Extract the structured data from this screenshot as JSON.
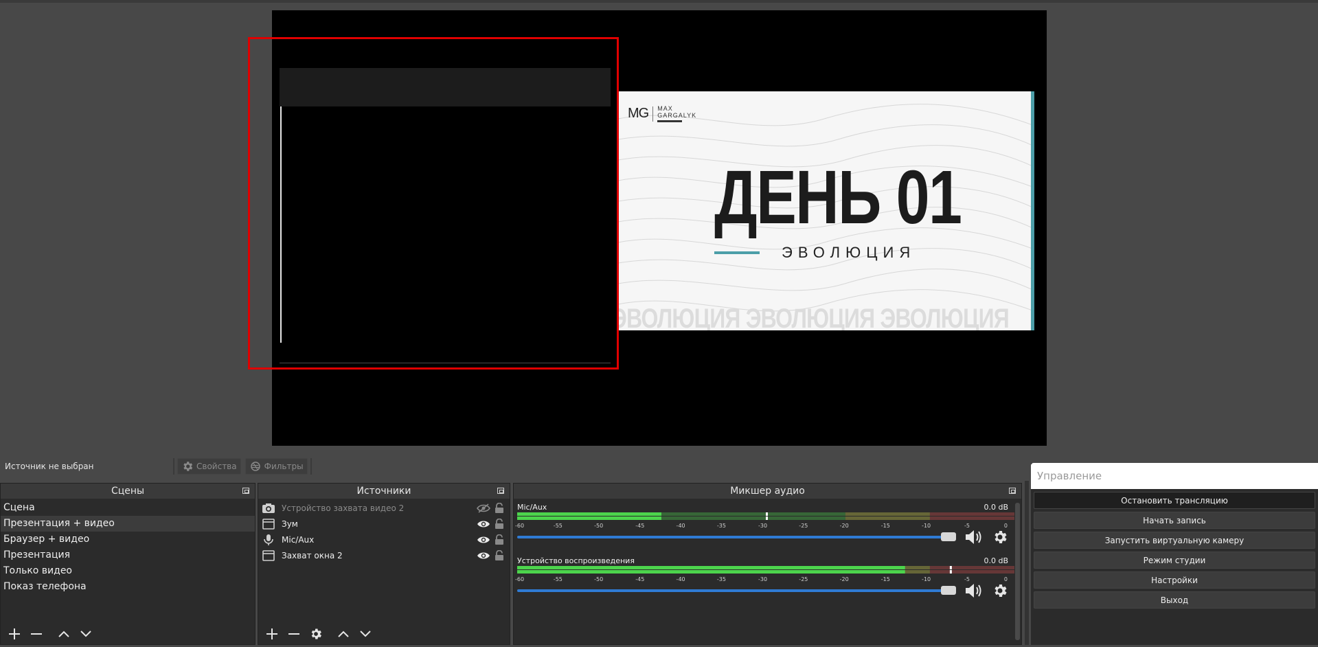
{
  "preview": {
    "slide_logo_mark": "MG",
    "slide_logo_name_line1": "MAX",
    "slide_logo_name_line2": "GARGALYK",
    "slide_title": "ДЕНЬ 01",
    "slide_subtitle": "ЭВОЛЮЦИЯ",
    "slide_repeat": "ЭВОЛЮЦИЯ ЭВОЛЮЦИЯ ЭВОЛЮЦИЯ"
  },
  "source_bar": {
    "status": "Источник не выбран",
    "properties_label": "Свойства",
    "filters_label": "Фильтры"
  },
  "scenes": {
    "title": "Сцены",
    "items": [
      {
        "label": "Сцена",
        "selected": false
      },
      {
        "label": "Презентация + видео",
        "selected": true
      },
      {
        "label": "Браузер + видео",
        "selected": false
      },
      {
        "label": "Презентация",
        "selected": false
      },
      {
        "label": "Только видео",
        "selected": false
      },
      {
        "label": "Показ телефона",
        "selected": false
      }
    ]
  },
  "sources": {
    "title": "Источники",
    "items": [
      {
        "label": "Устройство захвата видео 2",
        "icon": "camera-icon",
        "visible": false
      },
      {
        "label": "Зум",
        "icon": "window-icon",
        "visible": true
      },
      {
        "label": "Mic/Aux",
        "icon": "microphone-icon",
        "visible": true
      },
      {
        "label": "Захват окна 2",
        "icon": "window-icon",
        "visible": true
      }
    ]
  },
  "mixer": {
    "title": "Микшер аудио",
    "tick_labels": [
      "-60",
      "-55",
      "-50",
      "-45",
      "-40",
      "-35",
      "-30",
      "-25",
      "-20",
      "-15",
      "-10",
      "-5",
      "0"
    ],
    "channels": [
      {
        "name": "Mic/Aux",
        "db": "0.0 dB",
        "level_fraction": 0.29,
        "peak_fraction": 0.5,
        "volume_fraction": 1.0
      },
      {
        "name": "Устройство воспроизведения",
        "db": "0.0 dB",
        "level_fraction": 0.78,
        "peak_fraction": 0.87,
        "volume_fraction": 1.0
      }
    ]
  },
  "controls": {
    "title": "Управление",
    "buttons": [
      {
        "label": "Остановить трансляцию",
        "active": true
      },
      {
        "label": "Начать запись",
        "active": false
      },
      {
        "label": "Запустить виртуальную камеру",
        "active": false
      },
      {
        "label": "Режим студии",
        "active": false
      },
      {
        "label": "Настройки",
        "active": false
      },
      {
        "label": "Выход",
        "active": false
      }
    ]
  },
  "colors": {
    "selection_border": "#e00000",
    "slide_accent": "#4c9ea8",
    "fader": "#2f7bd4",
    "meter_green": "#4cd44c",
    "meter_yellow": "#d4d44c",
    "meter_red": "#d44c4c"
  }
}
